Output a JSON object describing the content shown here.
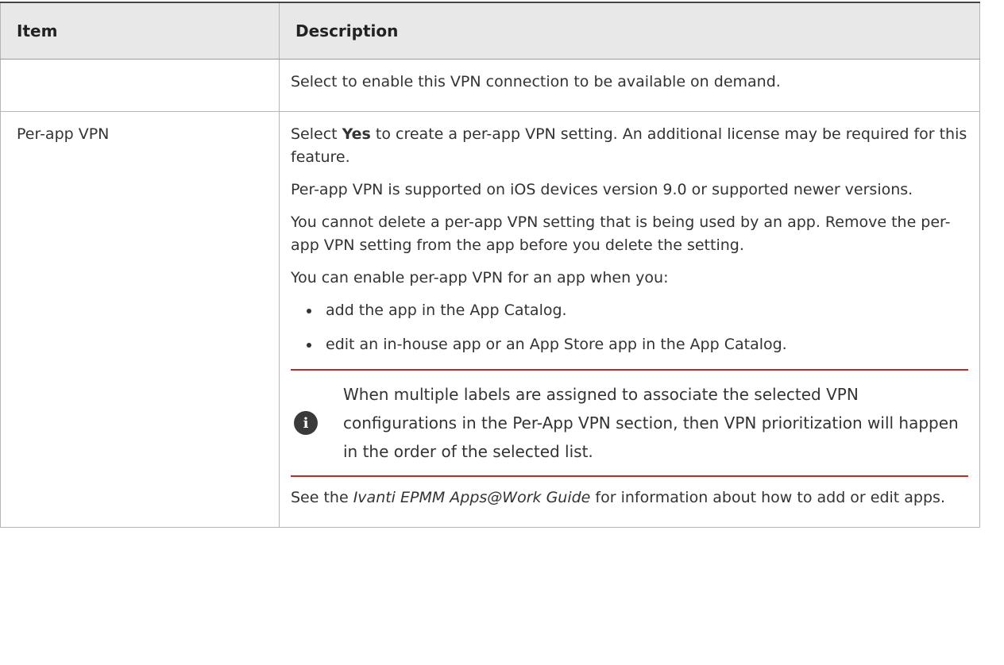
{
  "table": {
    "headers": {
      "item": "Item",
      "description": "Description"
    },
    "rows": [
      {
        "item": "",
        "description": "Select to enable this VPN connection to be available on demand."
      },
      {
        "item": "Per-app VPN",
        "p1_prefix": "Select ",
        "p1_bold": "Yes",
        "p1_suffix": " to create a per-app VPN setting. An additional license may be required for this feature.",
        "p2": "Per-app VPN is supported on iOS devices version 9.0 or supported newer versions.",
        "p3": "You cannot delete a per-app VPN setting that is being used by an app. Remove the per-app VPN setting from the app before you delete the setting.",
        "p4": "You can enable per-app VPN for an app when you:",
        "bullets": [
          "add the app in the App Catalog.",
          "edit an in-house app or an App Store app in the App Catalog."
        ],
        "note": {
          "icon": "info-icon",
          "text": "When multiple labels are assigned to associate the selected VPN configurations in the Per-App VPN section, then VPN prioritization will happen in the order of the selected list."
        },
        "p5_prefix": "See the ",
        "p5_italic": "Ivanti EPMM Apps@Work Guide",
        "p5_suffix": " for information about how to add or edit apps."
      }
    ]
  },
  "colors": {
    "note_rule": "#c0272d",
    "header_bg": "#e8e8e8"
  }
}
